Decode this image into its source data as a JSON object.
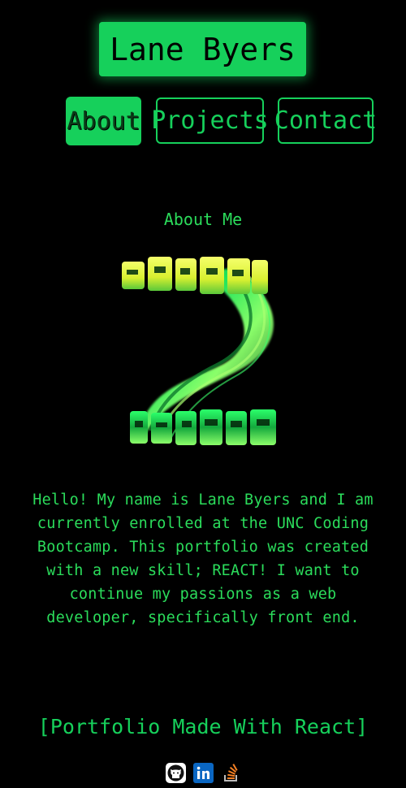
{
  "header": {
    "title": "Lane Byers"
  },
  "nav": {
    "items": [
      {
        "label": "About",
        "active": true
      },
      {
        "label": "Projects",
        "active": false
      },
      {
        "label": "Contact",
        "active": false
      }
    ]
  },
  "about": {
    "heading": "About Me",
    "bio": "Hello! My name is Lane Byers and I am currently enrolled at the UNC Coding Bootcamp. This portfolio was created with a new skill; REACT! I want to continue my passions as a web developer, specifically front end."
  },
  "footer": {
    "title": "[Portfolio Made With React]",
    "icons": [
      "github-icon",
      "linkedin-icon",
      "stack-overflow-icon"
    ]
  },
  "colors": {
    "background": "#000000",
    "accent": "#16d05b",
    "text": "#2bdc5b",
    "linkedin": "#0a66c2",
    "stack_overflow": "#f48024"
  }
}
